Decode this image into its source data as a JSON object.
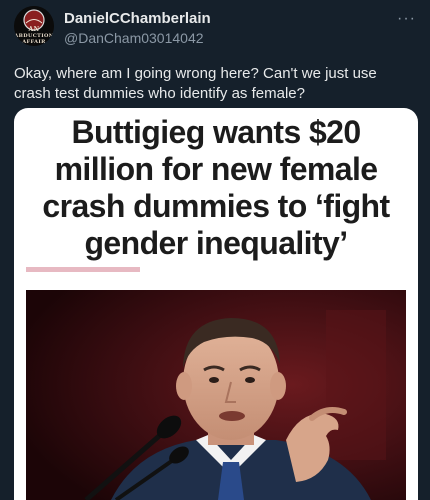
{
  "author": {
    "display_name": "DanielCChamberlain",
    "handle": "@DanCham03014042",
    "avatar_text": [
      "AN",
      "ABDUCTION",
      "AFFAIR"
    ]
  },
  "more_label": "···",
  "tweet": {
    "text": "Okay, where am I going wrong here? Can't we just use crash test dummies who identify as female?"
  },
  "article": {
    "headline": "Buttigieg wants $20 million for new female crash dummies to ‘fight gender inequality’",
    "accent_color": "#e7b9c2"
  },
  "colors": {
    "background": "#15202b",
    "text_primary": "#e7e9ea",
    "text_secondary": "#8b98a5"
  }
}
